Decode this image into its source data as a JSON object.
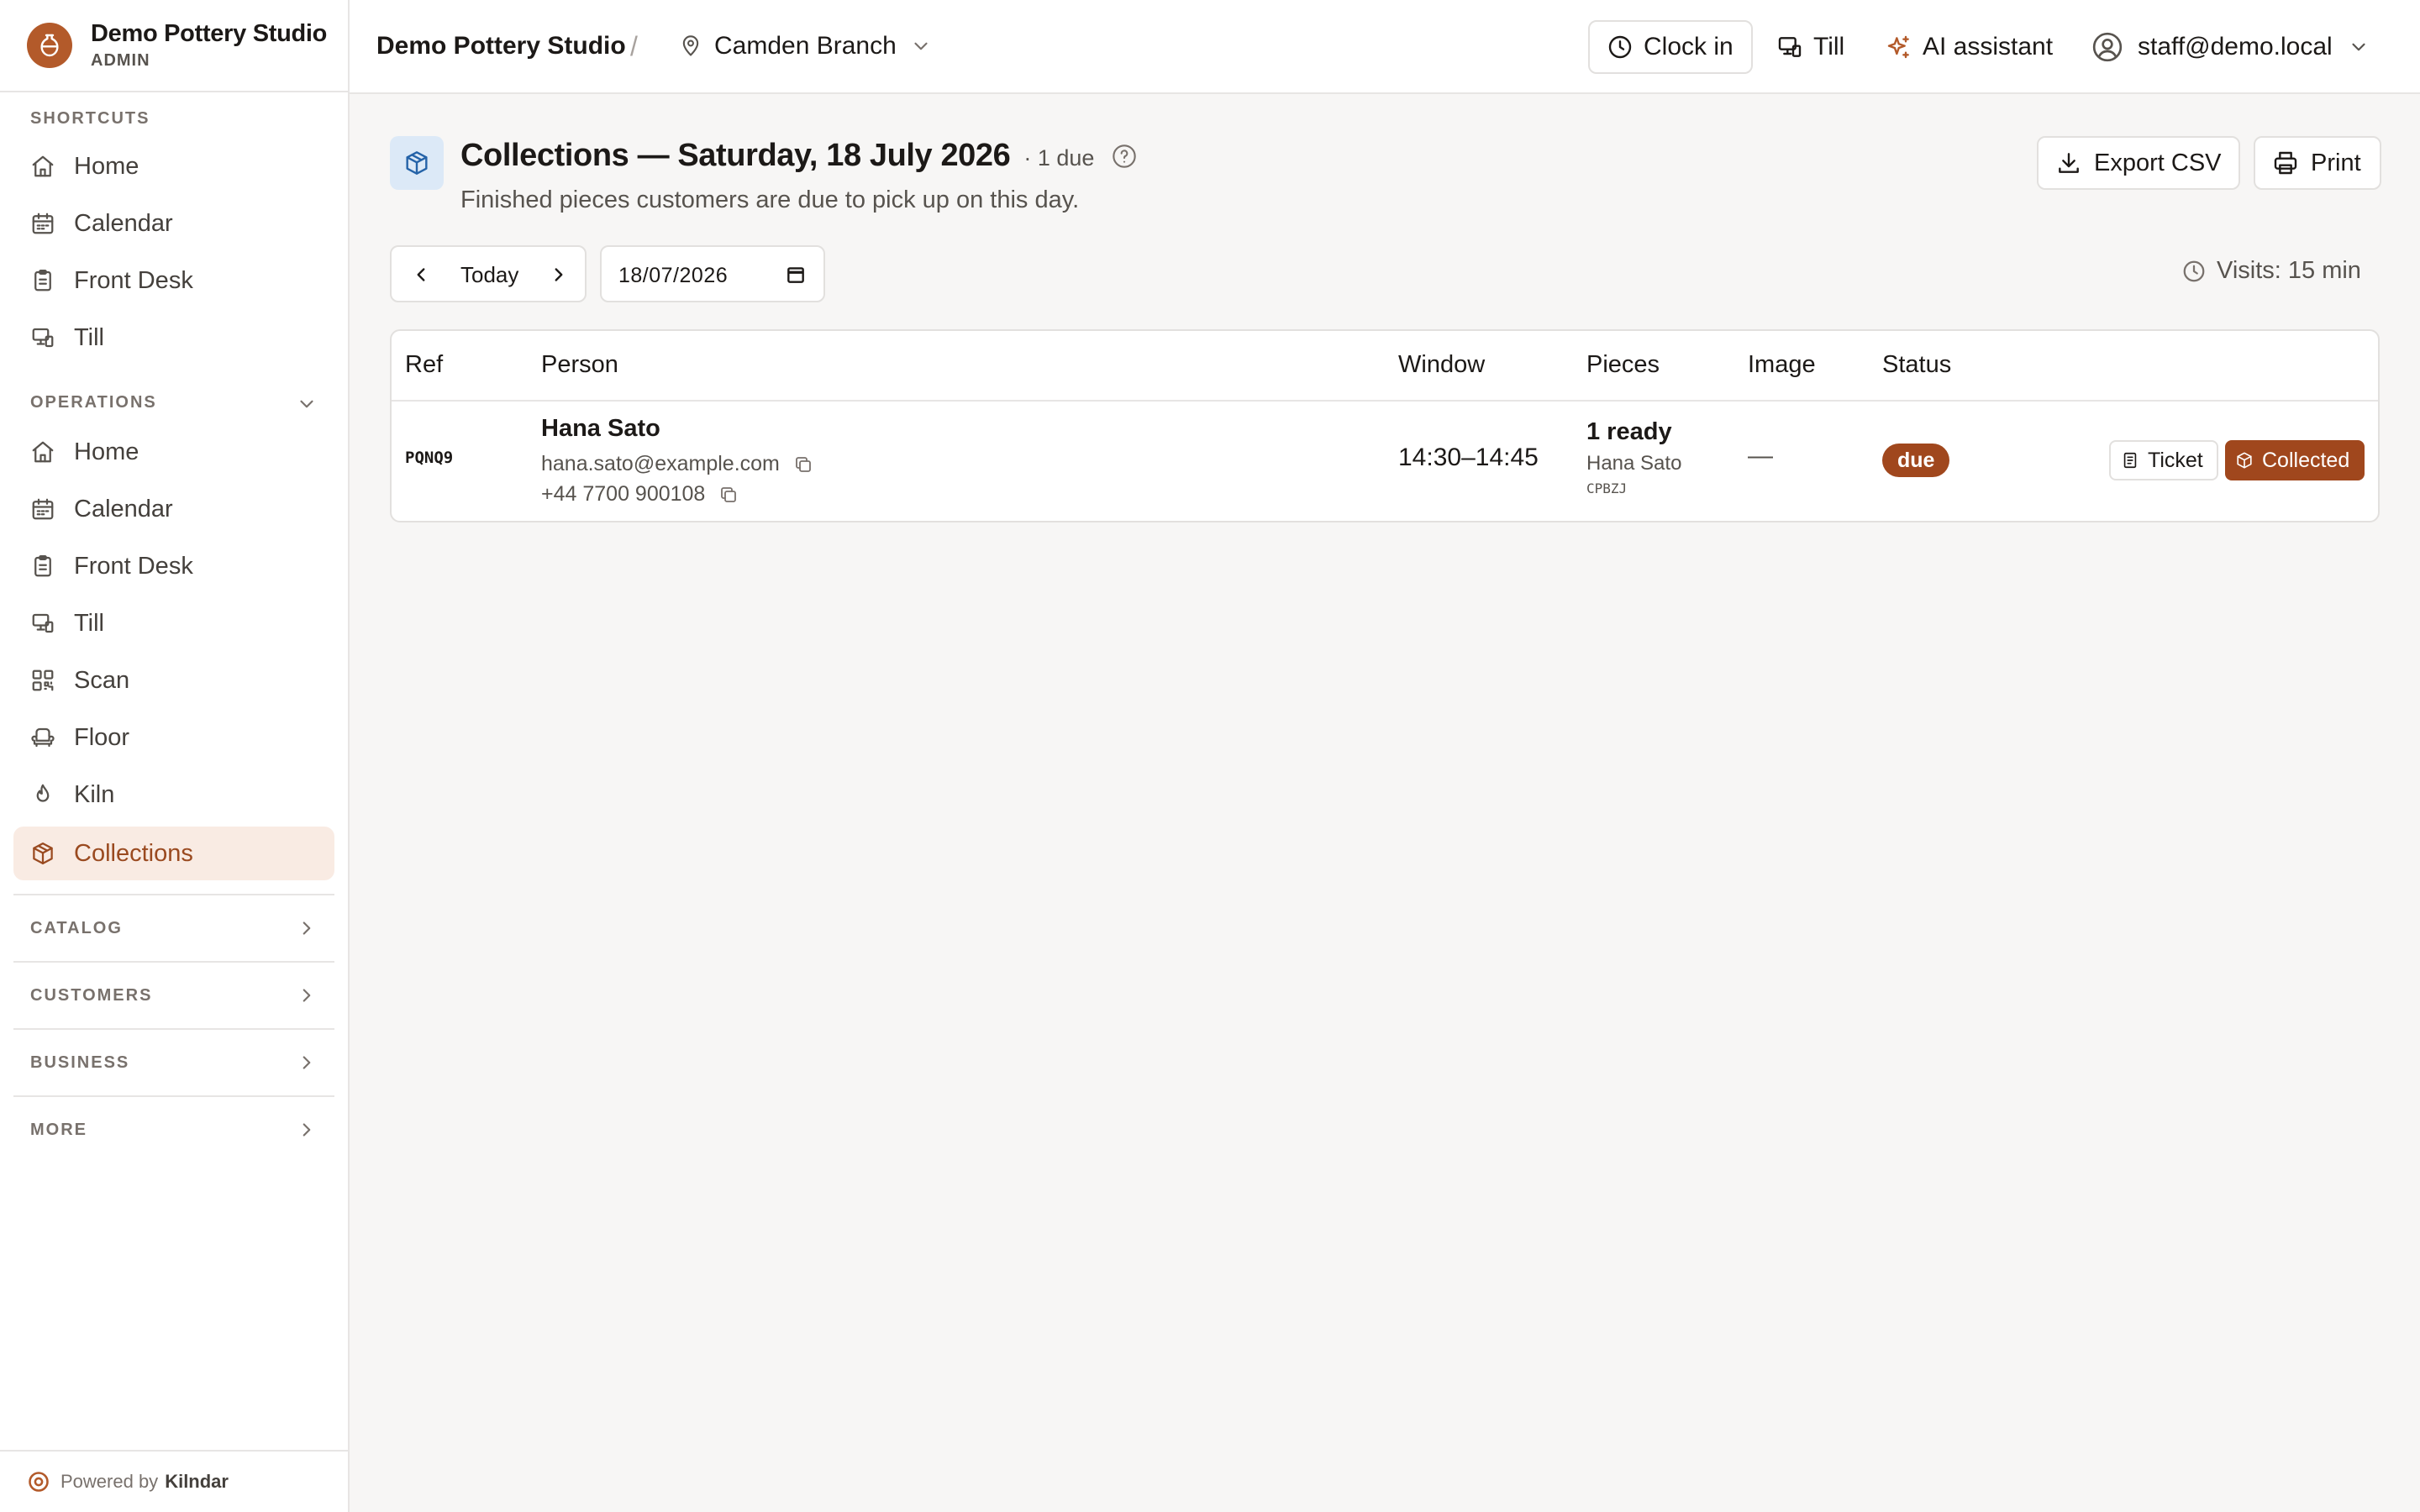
{
  "brand": {
    "name": "Demo Pottery Studio",
    "role": "ADMIN"
  },
  "sidebar": {
    "shortcuts_label": "SHORTCUTS",
    "shortcuts": [
      {
        "label": "Home",
        "icon": "home-icon"
      },
      {
        "label": "Calendar",
        "icon": "calendar-icon"
      },
      {
        "label": "Front Desk",
        "icon": "clipboard-icon"
      },
      {
        "label": "Till",
        "icon": "till-icon"
      }
    ],
    "operations_label": "OPERATIONS",
    "operations": [
      {
        "label": "Home",
        "icon": "home-icon"
      },
      {
        "label": "Calendar",
        "icon": "calendar-icon"
      },
      {
        "label": "Front Desk",
        "icon": "clipboard-icon"
      },
      {
        "label": "Till",
        "icon": "till-icon"
      },
      {
        "label": "Scan",
        "icon": "qr-code-icon"
      },
      {
        "label": "Floor",
        "icon": "armchair-icon"
      },
      {
        "label": "Kiln",
        "icon": "flame-icon"
      },
      {
        "label": "Collections",
        "icon": "package-icon",
        "active": true
      }
    ],
    "groups": [
      "CATALOG",
      "CUSTOMERS",
      "BUSINESS",
      "MORE"
    ],
    "powered_prefix": "Powered by",
    "powered_brand": "Kilndar"
  },
  "topbar": {
    "studio": "Demo Pottery Studio",
    "separator": "/",
    "branch": "Camden Branch",
    "clock_in": "Clock in",
    "till": "Till",
    "ai_assistant": "AI assistant",
    "user": "staff@demo.local"
  },
  "page": {
    "title": "Collections — Saturday, 18 July 2026",
    "due_count": "· 1 due",
    "subtitle": "Finished pieces customers are due to pick up on this day.",
    "export_label": "Export CSV",
    "print_label": "Print",
    "today_label": "Today",
    "date_value": "18/07/2026",
    "visits": "Visits: 15 min"
  },
  "table": {
    "columns": [
      "Ref",
      "Person",
      "Window",
      "Pieces",
      "Image",
      "Status"
    ],
    "rows": [
      {
        "ref": "PQNQ9",
        "name": "Hana Sato",
        "email": "hana.sato@example.com",
        "phone": "+44 7700 900108",
        "window": "14:30–14:45",
        "pieces_summary": "1 ready",
        "pieces_owner": "Hana Sato",
        "pieces_code": "CPBZJ",
        "image": "—",
        "status": "due",
        "ticket_label": "Ticket",
        "collected_label": "Collected"
      }
    ]
  },
  "colors": {
    "accent": "#a0471d",
    "active_bg": "#f9ebe3",
    "page_icon_bg": "#dce9f7"
  }
}
